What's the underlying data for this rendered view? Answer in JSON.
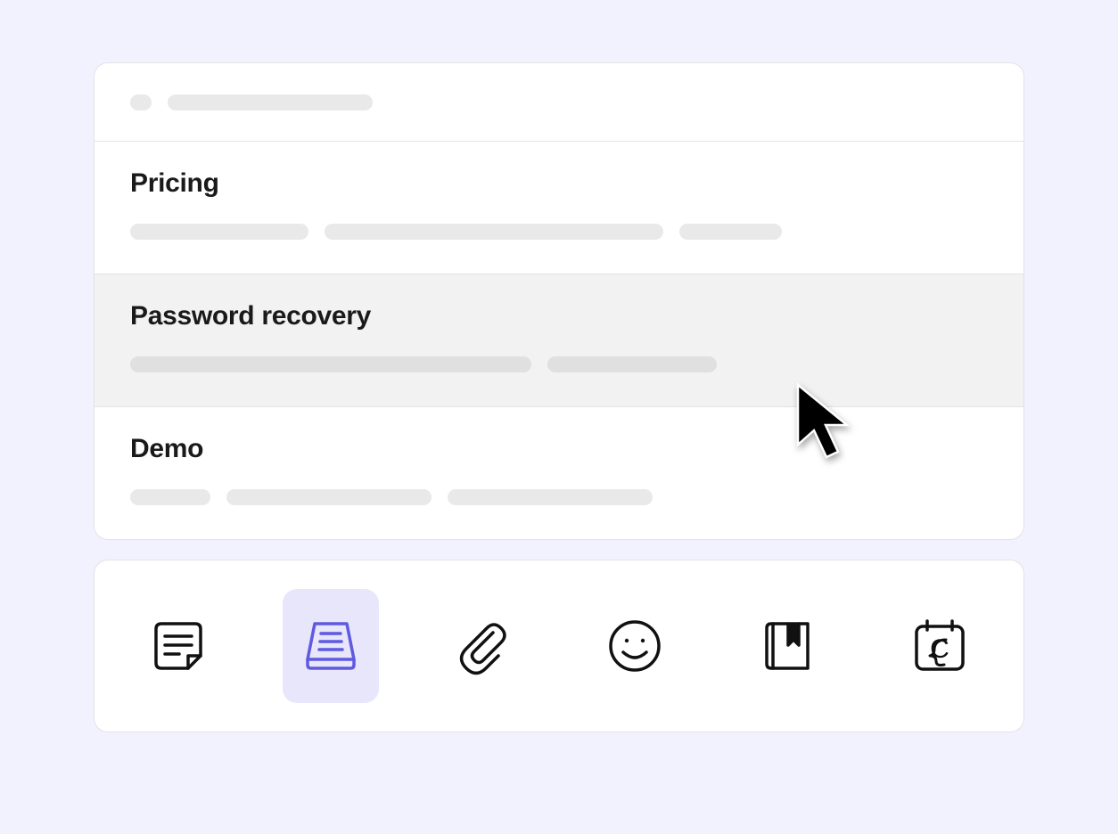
{
  "list": {
    "items": [
      {
        "title": "Pricing",
        "selected": false
      },
      {
        "title": "Password recovery",
        "selected": true
      },
      {
        "title": "Demo",
        "selected": false
      }
    ]
  },
  "toolbar": {
    "activeIndex": 1,
    "buttons": [
      {
        "name": "note-icon"
      },
      {
        "name": "inbox-icon"
      },
      {
        "name": "attachment-icon"
      },
      {
        "name": "emoji-icon"
      },
      {
        "name": "bookmark-icon"
      },
      {
        "name": "calendar-icon"
      }
    ]
  },
  "colors": {
    "accent": "#5F5AE0",
    "pageBg": "#F2F2FE",
    "panelBorder": "#E3E3E3",
    "selectedRow": "#F2F2F2",
    "activeTool": "#E8E6FB",
    "placeholder": "#E9E9E9"
  }
}
